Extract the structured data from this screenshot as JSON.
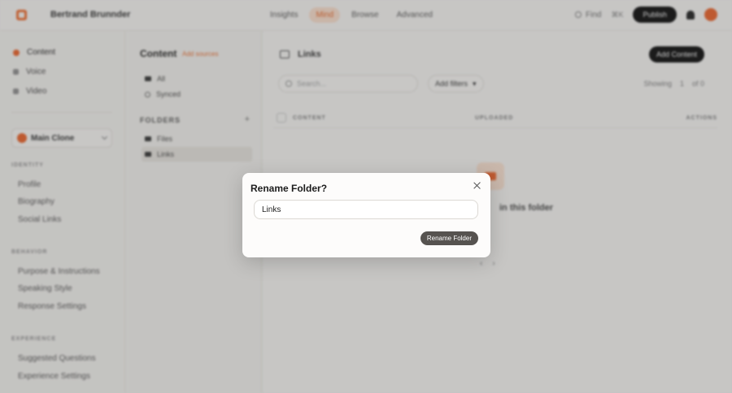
{
  "topbar": {
    "brand": "Bertrand Brunnder",
    "nav": [
      "Insights",
      "Mind",
      "Browse",
      "Advanced"
    ],
    "find": "Find",
    "shortcut": "⌘K",
    "publish": "Publish"
  },
  "sidebar": {
    "items": [
      "Content",
      "Voice",
      "Video"
    ],
    "clone_name": "Main Clone",
    "sections": [
      {
        "label": "IDENTITY",
        "items": [
          "Profile",
          "Biography",
          "Social Links"
        ]
      },
      {
        "label": "BEHAVIOR",
        "items": [
          "Purpose & Instructions",
          "Speaking Style",
          "Response Settings"
        ]
      },
      {
        "label": "EXPERIENCE",
        "items": [
          "Suggested Questions",
          "Experience Settings"
        ]
      }
    ]
  },
  "content_panel": {
    "title": "Content",
    "add_label": "Add sources",
    "rows": [
      "All",
      "Synced"
    ],
    "folders_label": "FOLDERS",
    "folders": [
      "Files",
      "Links"
    ]
  },
  "main": {
    "title": "Links",
    "add_button": "Add Content",
    "search_placeholder": "Search...",
    "filters_label": "Add filters",
    "showing": "Showing",
    "showing_page": "1",
    "showing_total": "of 0",
    "columns": [
      "CONTENT",
      "UPLOADED",
      "ACTIONS"
    ],
    "empty_text": "in this folder"
  },
  "modal": {
    "title": "Rename Folder?",
    "input_value": "Links",
    "button_label": "Rename Folder"
  },
  "colors": {
    "accent": "#ef6f3a",
    "dark": "#1e1e1e"
  }
}
